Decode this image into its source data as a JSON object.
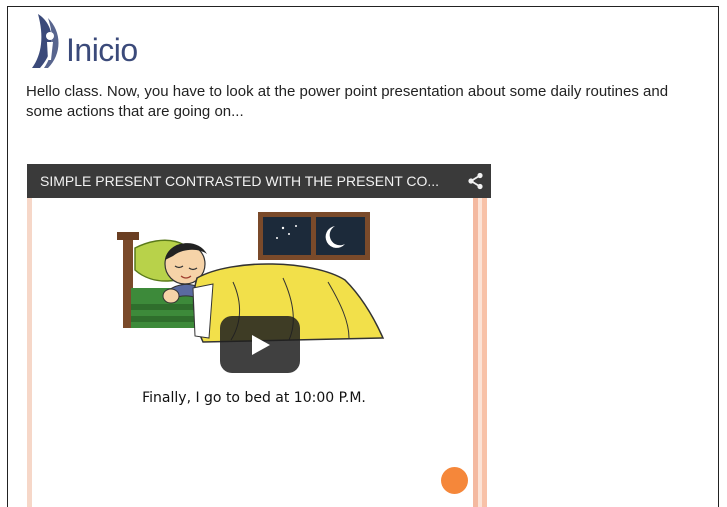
{
  "logo": {
    "text": "Inicio",
    "color": "#3b4a7a"
  },
  "intro": {
    "text": "Hello class. Now, you have to look at the power point presentation about some daily routines and some actions that are going on..."
  },
  "video": {
    "title": "SIMPLE PRESENT CONTRASTED WITH THE PRESENT CO...",
    "share_icon": "share-icon",
    "play_icon": "play-icon",
    "slide": {
      "caption": "Finally, I go to bed at 10:00 P.M."
    },
    "accent_color": "#f5873a"
  }
}
